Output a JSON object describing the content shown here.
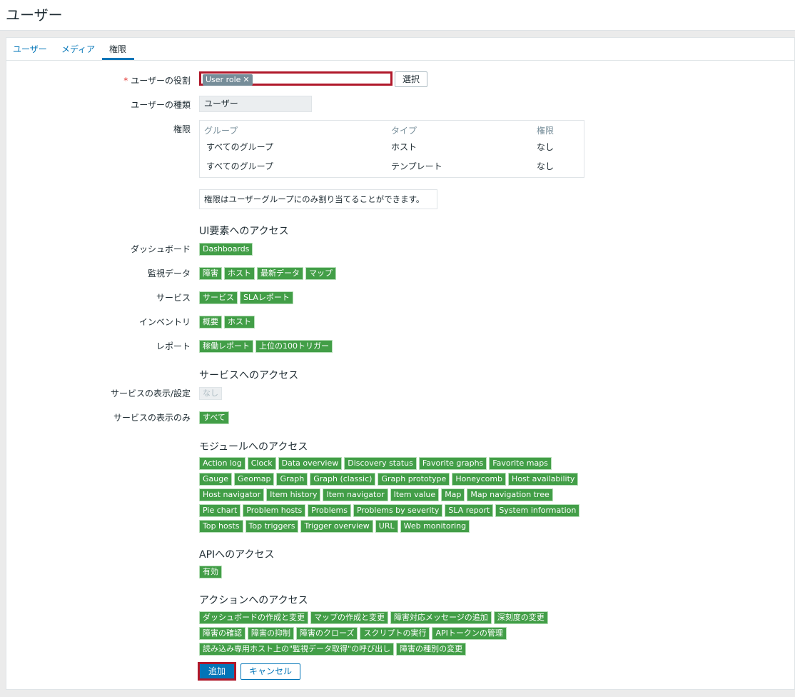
{
  "page": {
    "title": "ユーザー"
  },
  "tabs": [
    {
      "label": "ユーザー"
    },
    {
      "label": "メディア"
    },
    {
      "label": "権限"
    }
  ],
  "form": {
    "user_role_label": "ユーザーの役割",
    "user_role_required": "*",
    "user_role_chip": "User role",
    "select_button": "選択",
    "user_type_label": "ユーザーの種類",
    "user_type_value": "ユーザー",
    "permissions_label": "権限",
    "permissions_table": {
      "headers": [
        "グループ",
        "タイプ",
        "権限"
      ],
      "rows": [
        [
          "すべてのグループ",
          "ホスト",
          "なし"
        ],
        [
          "すべてのグループ",
          "テンプレート",
          "なし"
        ]
      ]
    },
    "permissions_info": "権限はユーザーグループにのみ割り当てることができます。"
  },
  "ui_access": {
    "title": "UI要素へのアクセス",
    "rows": [
      {
        "label": "ダッシュボード",
        "tags": [
          "Dashboards"
        ]
      },
      {
        "label": "監視データ",
        "tags": [
          "障害",
          "ホスト",
          "最新データ",
          "マップ"
        ]
      },
      {
        "label": "サービス",
        "tags": [
          "サービス",
          "SLAレポート"
        ]
      },
      {
        "label": "インベントリ",
        "tags": [
          "概要",
          "ホスト"
        ]
      },
      {
        "label": "レポート",
        "tags": [
          "稼働レポート",
          "上位の100トリガー"
        ]
      }
    ]
  },
  "service_access": {
    "title": "サービスへのアクセス",
    "rows": [
      {
        "label": "サービスの表示/設定",
        "tags": [
          "なし"
        ]
      },
      {
        "label": "サービスの表示のみ",
        "tags": [
          "すべて"
        ]
      }
    ]
  },
  "module_access": {
    "title": "モジュールへのアクセス",
    "tags": [
      "Action log",
      "Clock",
      "Data overview",
      "Discovery status",
      "Favorite graphs",
      "Favorite maps",
      "Gauge",
      "Geomap",
      "Graph",
      "Graph (classic)",
      "Graph prototype",
      "Honeycomb",
      "Host availability",
      "Host navigator",
      "Item history",
      "Item navigator",
      "Item value",
      "Map",
      "Map navigation tree",
      "Pie chart",
      "Problem hosts",
      "Problems",
      "Problems by severity",
      "SLA report",
      "System information",
      "Top hosts",
      "Top triggers",
      "Trigger overview",
      "URL",
      "Web monitoring"
    ]
  },
  "api_access": {
    "title": "APIへのアクセス",
    "tags": [
      "有効"
    ]
  },
  "action_access": {
    "title": "アクションへのアクセス",
    "tags": [
      "ダッシュボードの作成と変更",
      "マップの作成と変更",
      "障害対応メッセージの追加",
      "深刻度の変更",
      "障害の確認",
      "障害の抑制",
      "障害のクローズ",
      "スクリプトの実行",
      "APIトークンの管理",
      "読み込み専用ホスト上の\"監視データ取得\"の呼び出し",
      "障害の種別の変更"
    ]
  },
  "buttons": {
    "add": "追加",
    "cancel": "キャンセル"
  },
  "colors": {
    "accent": "#0275b8",
    "tag_green": "#429e47",
    "highlight_red": "#b0182a"
  }
}
